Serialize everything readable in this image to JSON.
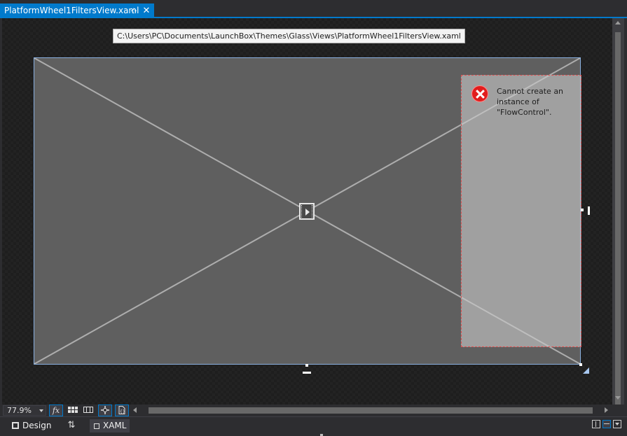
{
  "tab": {
    "title": "PlatformWheel1FiltersView.xaml",
    "pin_glyph": "⊹",
    "close_glyph": "✕"
  },
  "designer": {
    "path_tooltip": "C:\\Users\\PC\\Documents\\LaunchBox\\Themes\\Glass\\Views\\PlatformWheel1FiltersView.xaml",
    "error_message": "Cannot create an instance of \"FlowControl\"."
  },
  "zoom": {
    "value": "77.9%",
    "fx_label": "fx"
  },
  "views": {
    "design_label": "Design",
    "swap_glyph": "⇅",
    "xaml_label": "XAML"
  },
  "colors": {
    "accent": "#007acc",
    "error": "#e11d1d",
    "background": "#2d2d30"
  }
}
